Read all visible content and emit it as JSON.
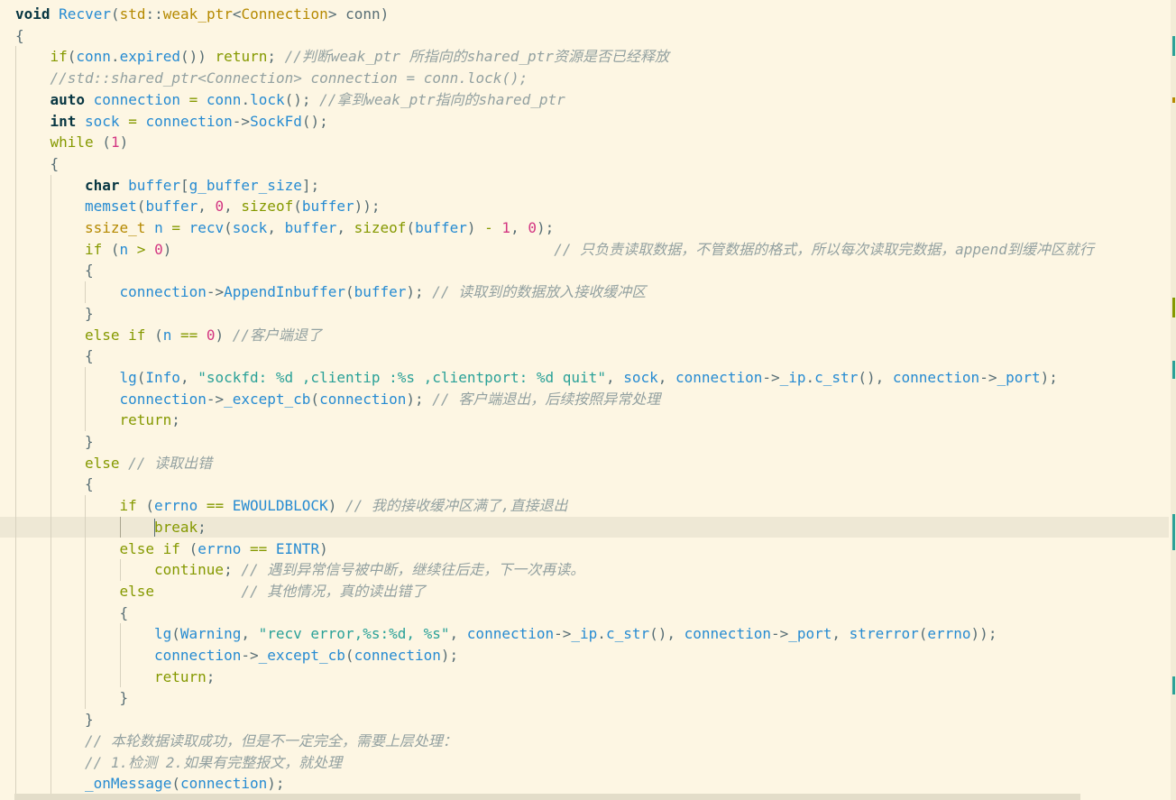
{
  "editor": {
    "lines": [
      [
        [
          "kw",
          "void "
        ],
        [
          "fn",
          "Recver"
        ],
        [
          "pn",
          "("
        ],
        [
          "ns",
          "std"
        ],
        [
          "pn",
          "::"
        ],
        [
          "ty",
          "weak_ptr"
        ],
        [
          "pn",
          "<"
        ],
        [
          "ty",
          "Connection"
        ],
        [
          "pn",
          "> conn)"
        ]
      ],
      [
        [
          "pn",
          "{"
        ]
      ],
      [
        [
          "cf",
          "if"
        ],
        [
          "pn",
          "("
        ],
        [
          "var",
          "conn"
        ],
        [
          "pn",
          "."
        ],
        [
          "fn",
          "expired"
        ],
        [
          "pn",
          "()) "
        ],
        [
          "cf",
          "return"
        ],
        [
          "pn",
          "; "
        ],
        [
          "cm",
          "//判断weak_ptr 所指向的shared_ptr资源是否已经释放"
        ]
      ],
      [
        [
          "cm",
          "//std::shared_ptr<Connection> connection = conn.lock();"
        ]
      ],
      [
        [
          "kw",
          "auto "
        ],
        [
          "var",
          "connection"
        ],
        [
          "op",
          " = "
        ],
        [
          "var",
          "conn"
        ],
        [
          "pn",
          "."
        ],
        [
          "fn",
          "lock"
        ],
        [
          "pn",
          "(); "
        ],
        [
          "cm",
          "//拿到weak_ptr指向的shared_ptr"
        ]
      ],
      [
        [
          "kw",
          "int "
        ],
        [
          "var",
          "sock"
        ],
        [
          "op",
          " = "
        ],
        [
          "var",
          "connection"
        ],
        [
          "pn",
          "->"
        ],
        [
          "fn",
          "SockFd"
        ],
        [
          "pn",
          "();"
        ]
      ],
      [
        [
          "cf",
          "while"
        ],
        [
          "pn",
          " ("
        ],
        [
          "num",
          "1"
        ],
        [
          "pn",
          ")"
        ]
      ],
      [
        [
          "pn",
          "{"
        ]
      ],
      [
        [
          "kw",
          "char "
        ],
        [
          "var",
          "buffer"
        ],
        [
          "pn",
          "["
        ],
        [
          "var",
          "g_buffer_size"
        ],
        [
          "pn",
          "];"
        ]
      ],
      [
        [
          "fn",
          "memset"
        ],
        [
          "pn",
          "("
        ],
        [
          "var",
          "buffer"
        ],
        [
          "pn",
          ", "
        ],
        [
          "num",
          "0"
        ],
        [
          "pn",
          ", "
        ],
        [
          "cf",
          "sizeof"
        ],
        [
          "pn",
          "("
        ],
        [
          "var",
          "buffer"
        ],
        [
          "pn",
          "));"
        ]
      ],
      [
        [
          "ty",
          "ssize_t "
        ],
        [
          "var",
          "n"
        ],
        [
          "op",
          " = "
        ],
        [
          "fn",
          "recv"
        ],
        [
          "pn",
          "("
        ],
        [
          "var",
          "sock"
        ],
        [
          "pn",
          ", "
        ],
        [
          "var",
          "buffer"
        ],
        [
          "pn",
          ", "
        ],
        [
          "cf",
          "sizeof"
        ],
        [
          "pn",
          "("
        ],
        [
          "var",
          "buffer"
        ],
        [
          "pn",
          ")"
        ],
        [
          "op",
          " - "
        ],
        [
          "num",
          "1"
        ],
        [
          "pn",
          ", "
        ],
        [
          "num",
          "0"
        ],
        [
          "pn",
          ");"
        ]
      ],
      [
        [
          "cf",
          "if"
        ],
        [
          "pn",
          " ("
        ],
        [
          "var",
          "n"
        ],
        [
          "op",
          " > "
        ],
        [
          "num",
          "0"
        ],
        [
          "pn",
          ")"
        ],
        [
          "pn",
          "                                            "
        ],
        [
          "cm",
          "// 只负责读取数据，不管数据的格式，所以每次读取完数据，append到缓冲区就行"
        ]
      ],
      [
        [
          "pn",
          "{"
        ]
      ],
      [
        [
          "var",
          "connection"
        ],
        [
          "pn",
          "->"
        ],
        [
          "fn",
          "AppendInbuffer"
        ],
        [
          "pn",
          "("
        ],
        [
          "var",
          "buffer"
        ],
        [
          "pn",
          "); "
        ],
        [
          "cm",
          "// 读取到的数据放入接收缓冲区"
        ]
      ],
      [
        [
          "pn",
          "}"
        ]
      ],
      [
        [
          "cf",
          "else if"
        ],
        [
          "pn",
          " ("
        ],
        [
          "var",
          "n"
        ],
        [
          "op",
          " == "
        ],
        [
          "num",
          "0"
        ],
        [
          "pn",
          ") "
        ],
        [
          "cm",
          "//客户端退了"
        ]
      ],
      [
        [
          "pn",
          "{"
        ]
      ],
      [
        [
          "fn",
          "lg"
        ],
        [
          "pn",
          "("
        ],
        [
          "var",
          "Info"
        ],
        [
          "pn",
          ", "
        ],
        [
          "str",
          "\"sockfd: %d ,clientip :%s ,clientport: %d quit\""
        ],
        [
          "pn",
          ", "
        ],
        [
          "var",
          "sock"
        ],
        [
          "pn",
          ", "
        ],
        [
          "var",
          "connection"
        ],
        [
          "pn",
          "->"
        ],
        [
          "var",
          "_ip"
        ],
        [
          "pn",
          "."
        ],
        [
          "fn",
          "c_str"
        ],
        [
          "pn",
          "(), "
        ],
        [
          "var",
          "connection"
        ],
        [
          "pn",
          "->"
        ],
        [
          "var",
          "_port"
        ],
        [
          "pn",
          ");"
        ]
      ],
      [
        [
          "var",
          "connection"
        ],
        [
          "pn",
          "->"
        ],
        [
          "fn",
          "_except_cb"
        ],
        [
          "pn",
          "("
        ],
        [
          "var",
          "connection"
        ],
        [
          "pn",
          "); "
        ],
        [
          "cm",
          "// 客户端退出，后续按照异常处理"
        ]
      ],
      [
        [
          "cf",
          "return"
        ],
        [
          "pn",
          ";"
        ]
      ],
      [
        [
          "pn",
          "}"
        ]
      ],
      [
        [
          "cf",
          "else"
        ],
        [
          "pn",
          " "
        ],
        [
          "cm",
          "// 读取出错"
        ]
      ],
      [
        [
          "pn",
          "{"
        ]
      ],
      [
        [
          "cf",
          "if"
        ],
        [
          "pn",
          " ("
        ],
        [
          "var",
          "errno"
        ],
        [
          "op",
          " == "
        ],
        [
          "var",
          "EWOULDBLOCK"
        ],
        [
          "pn",
          ") "
        ],
        [
          "cm",
          "// 我的接收缓冲区满了,直接退出"
        ]
      ],
      [
        [
          "cf",
          "break"
        ],
        [
          "pn",
          ";"
        ]
      ],
      [
        [
          "cf",
          "else if"
        ],
        [
          "pn",
          " ("
        ],
        [
          "var",
          "errno"
        ],
        [
          "op",
          " == "
        ],
        [
          "var",
          "EINTR"
        ],
        [
          "pn",
          ")"
        ]
      ],
      [
        [
          "cf",
          "continue"
        ],
        [
          "pn",
          "; "
        ],
        [
          "cm",
          "// 遇到异常信号被中断，继续往后走，下一次再读。"
        ]
      ],
      [
        [
          "cf",
          "else"
        ],
        [
          "pn",
          "          "
        ],
        [
          "cm",
          "// 其他情况，真的读出错了"
        ]
      ],
      [
        [
          "pn",
          "{"
        ]
      ],
      [
        [
          "fn",
          "lg"
        ],
        [
          "pn",
          "("
        ],
        [
          "var",
          "Warning"
        ],
        [
          "pn",
          ", "
        ],
        [
          "str",
          "\"recv error,%s:%d, %s\""
        ],
        [
          "pn",
          ", "
        ],
        [
          "var",
          "connection"
        ],
        [
          "pn",
          "->"
        ],
        [
          "var",
          "_ip"
        ],
        [
          "pn",
          "."
        ],
        [
          "fn",
          "c_str"
        ],
        [
          "pn",
          "(), "
        ],
        [
          "var",
          "connection"
        ],
        [
          "pn",
          "->"
        ],
        [
          "var",
          "_port"
        ],
        [
          "pn",
          ", "
        ],
        [
          "fn",
          "strerror"
        ],
        [
          "pn",
          "("
        ],
        [
          "var",
          "errno"
        ],
        [
          "pn",
          "));"
        ]
      ],
      [
        [
          "var",
          "connection"
        ],
        [
          "pn",
          "->"
        ],
        [
          "fn",
          "_except_cb"
        ],
        [
          "pn",
          "("
        ],
        [
          "var",
          "connection"
        ],
        [
          "pn",
          ");"
        ]
      ],
      [
        [
          "cf",
          "return"
        ],
        [
          "pn",
          ";"
        ]
      ],
      [
        [
          "pn",
          "}"
        ]
      ],
      [
        [
          "pn",
          "}"
        ]
      ],
      [
        [
          "cm",
          "// 本轮数据读取成功，但是不一定完全，需要上层处理："
        ]
      ],
      [
        [
          "cm",
          "// 1.检测 2.如果有完整报文，就处理"
        ]
      ],
      [
        [
          "fn",
          "_onMessage"
        ],
        [
          "pn",
          "("
        ],
        [
          "var",
          "connection"
        ],
        [
          "pn",
          ");"
        ]
      ]
    ]
  }
}
